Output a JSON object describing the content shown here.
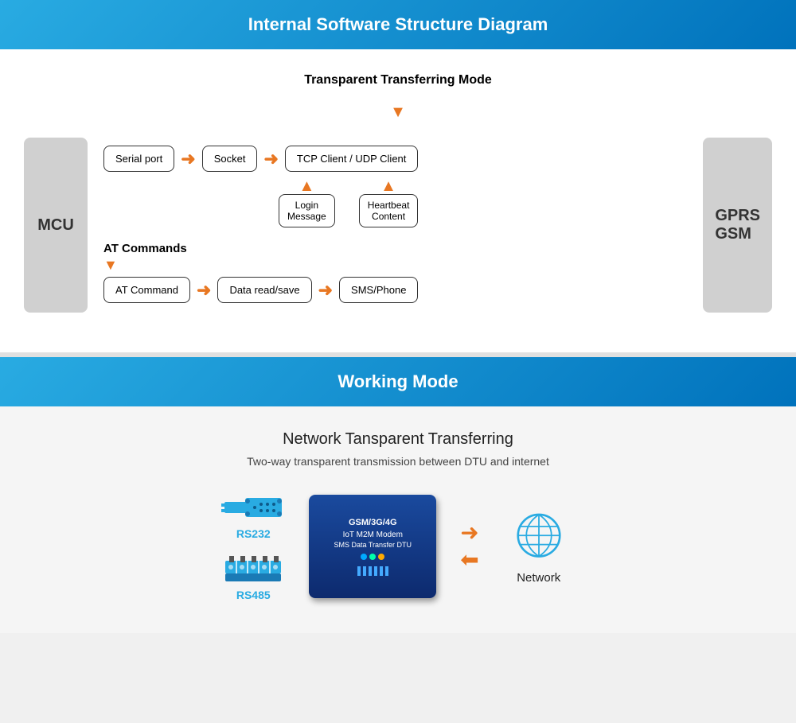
{
  "section1": {
    "title": "Internal Software Structure Diagram",
    "diagram_title": "Transparent Transferring Mode",
    "mcu_label": "MCU",
    "gprs_label": "GPRS\nGSM",
    "flow1": {
      "serial_port": "Serial port",
      "socket": "Socket",
      "tcp_client": "TCP Client / UDP Client",
      "login_message": "Login\nMessage",
      "heartbeat_content": "Heartbeat\nContent"
    },
    "at_commands_title": "AT Commands",
    "flow2": {
      "at_command": "AT Command",
      "data_read_save": "Data read/save",
      "sms_phone": "SMS/Phone"
    }
  },
  "section2": {
    "title": "Working Mode",
    "network_title": "Network Tansparent Transferring",
    "network_subtitle": "Two-way transparent transmission between DTU and internet",
    "rs232_label": "RS232",
    "rs485_label": "RS485",
    "network_label": "Network",
    "modem_text": "GSM/3G/4G\nIoT M2M Modem\nSMS Data Transfer DTU"
  }
}
